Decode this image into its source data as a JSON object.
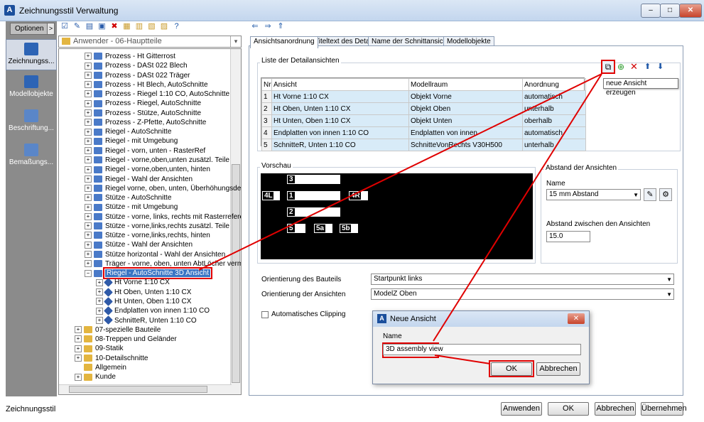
{
  "window": {
    "title": "Zeichnungsstil Verwaltung",
    "min": "–",
    "max": "□",
    "close": "✕"
  },
  "sidebar": {
    "options_label": "Optionen",
    "options_arrow": ">",
    "items": [
      {
        "label": "Zeichnungss...",
        "icon": "drawing-style-icon"
      },
      {
        "label": "Modellobjekte",
        "icon": "model-objects-icon"
      },
      {
        "label": "Beschriftung...",
        "icon": "annotation-icon"
      },
      {
        "label": "Bemaßungs...",
        "icon": "dimension-icon"
      }
    ]
  },
  "toolbar": {
    "icons": [
      "☑",
      "✎",
      "▤",
      "▣",
      "✖",
      "▦",
      "▥",
      "▧",
      "▨",
      "?"
    ],
    "nav": [
      "⇐",
      "⇒",
      "⇑"
    ]
  },
  "combo": {
    "value": "Anwender - 06-Hauptteile",
    "arrow": "▾"
  },
  "tree": {
    "items": [
      {
        "label": "Prozess - Ht Gitterrost",
        "level": 2,
        "kind": "style"
      },
      {
        "label": "Prozess - DASt 022 Blech",
        "level": 2,
        "kind": "style"
      },
      {
        "label": "Prozess - DASt 022 Träger",
        "level": 2,
        "kind": "style"
      },
      {
        "label": "Prozess - Ht Blech, AutoSchnitte",
        "level": 2,
        "kind": "style"
      },
      {
        "label": "Prozess - Riegel 1:10 CO, AutoSchnitte",
        "level": 2,
        "kind": "style"
      },
      {
        "label": "Prozess - Riegel, AutoSchnitte",
        "level": 2,
        "kind": "style"
      },
      {
        "label": "Prozess - Stütze, AutoSchnitte",
        "level": 2,
        "kind": "style"
      },
      {
        "label": "Prozess - Z-Pfette, AutoSchnitte",
        "level": 2,
        "kind": "style"
      },
      {
        "label": "Riegel - AutoSchnitte",
        "level": 2,
        "kind": "style"
      },
      {
        "label": "Riegel - mit Umgebung",
        "level": 2,
        "kind": "style"
      },
      {
        "label": "Riegel - vorn, unten - RasterRef",
        "level": 2,
        "kind": "style"
      },
      {
        "label": "Riegel - vorne,oben,unten zusätzl. Teile",
        "level": 2,
        "kind": "style"
      },
      {
        "label": "Riegel - vorne,oben,unten, hinten",
        "level": 2,
        "kind": "style"
      },
      {
        "label": "Riegel - Wahl der Ansichten",
        "level": 2,
        "kind": "style"
      },
      {
        "label": "Riegel vorne, oben, unten, Überhöhungsdetai",
        "level": 2,
        "kind": "style"
      },
      {
        "label": "Stütze - AutoSchnitte",
        "level": 2,
        "kind": "style"
      },
      {
        "label": "Stütze - mit Umgebung",
        "level": 2,
        "kind": "style"
      },
      {
        "label": "Stütze - vorne, links, rechts mit Rasterreferenz",
        "level": 2,
        "kind": "style"
      },
      {
        "label": "Stütze - vorne,links,rechts zusätzl. Teile",
        "level": 2,
        "kind": "style"
      },
      {
        "label": "Stütze - vorne,links,rechts, hinten",
        "level": 2,
        "kind": "style"
      },
      {
        "label": "Stütze - Wahl der Ansichten",
        "level": 2,
        "kind": "style"
      },
      {
        "label": "Stütze horizontal - Wahl der Ansichten",
        "level": 2,
        "kind": "style"
      },
      {
        "label": "Träger - vorne, oben, unten AbtLöcher verma",
        "level": 2,
        "kind": "style"
      },
      {
        "label": "Riegel - AutoSchnitte 3D Ansicht",
        "level": 2,
        "kind": "style",
        "selected": true,
        "expanded": true
      },
      {
        "label": "Ht Vorne 1:10 CX",
        "level": 3,
        "kind": "sub"
      },
      {
        "label": "Ht Oben, Unten 1:10 CX",
        "level": 3,
        "kind": "sub"
      },
      {
        "label": "Ht Unten, Oben 1:10 CX",
        "level": 3,
        "kind": "sub"
      },
      {
        "label": "Endplatten von innen 1:10 CO",
        "level": 3,
        "kind": "sub"
      },
      {
        "label": "SchnitteR, Unten 1:10 CO",
        "level": 3,
        "kind": "sub"
      },
      {
        "label": "07-spezielle Bauteile",
        "level": 1,
        "kind": "folder"
      },
      {
        "label": "08-Treppen und Geländer",
        "level": 1,
        "kind": "folder"
      },
      {
        "label": "09-Statik",
        "level": 1,
        "kind": "folder"
      },
      {
        "label": "10-Detailschnitte",
        "level": 1,
        "kind": "folder"
      },
      {
        "label": "Allgemein",
        "level": 1,
        "kind": "folder-open"
      },
      {
        "label": "Kunde",
        "level": 1,
        "kind": "folder"
      }
    ]
  },
  "tabs": [
    "Ansichtsanordnung",
    "Titeltext des Detail",
    "Name der Schnittansicht",
    "Modellobjekte"
  ],
  "details": {
    "group_label": "Liste der Detailansichten",
    "tooltip": "neue Ansicht erzeugen",
    "columns": [
      "Nr",
      "Ansicht",
      "Modellraum",
      "Anordnung"
    ],
    "rows": [
      [
        "1",
        "Ht Vorne 1:10 CX",
        "Objekt Vorne",
        "automatisch"
      ],
      [
        "2",
        "Ht Oben, Unten 1:10 CX",
        "Objekt Oben",
        "unterhalb"
      ],
      [
        "3",
        "Ht Unten, Oben 1:10 CX",
        "Objekt Unten",
        "oberhalb"
      ],
      [
        "4",
        "Endplatten von innen 1:10 CO",
        "Endplatten von innen",
        "automatisch"
      ],
      [
        "5",
        "SchnitteR, Unten 1:10 CO",
        "SchnitteVonRechts V30H500",
        "unterhalb"
      ]
    ]
  },
  "preview": {
    "label": "Vorschau",
    "boxes": [
      "3",
      "4L",
      "1",
      "4R",
      "2",
      "5",
      "5a",
      "5b"
    ]
  },
  "spacing": {
    "group_label": "Abstand der Ansichten",
    "name_label": "Name",
    "name_value": "15 mm Abstand",
    "between_label": "Abstand zwischen den Ansichten",
    "between_value": "15.0"
  },
  "orientation": {
    "part_label": "Orientierung des Bauteils",
    "part_value": "Startpunkt links",
    "views_label": "Orientierung der Ansichten",
    "views_value": "ModelZ Oben"
  },
  "clipping": {
    "label": "Automatisches Clipping"
  },
  "dialog": {
    "title": "Neue Ansicht",
    "name_label": "Name",
    "name_value": "3D assembly view",
    "ok": "OK",
    "cancel": "Abbrechen"
  },
  "footer": {
    "status": "Zeichnungsstil",
    "apply": "Anwenden",
    "ok": "OK",
    "cancel": "Abbrechen",
    "accept": "Übernehmen"
  }
}
